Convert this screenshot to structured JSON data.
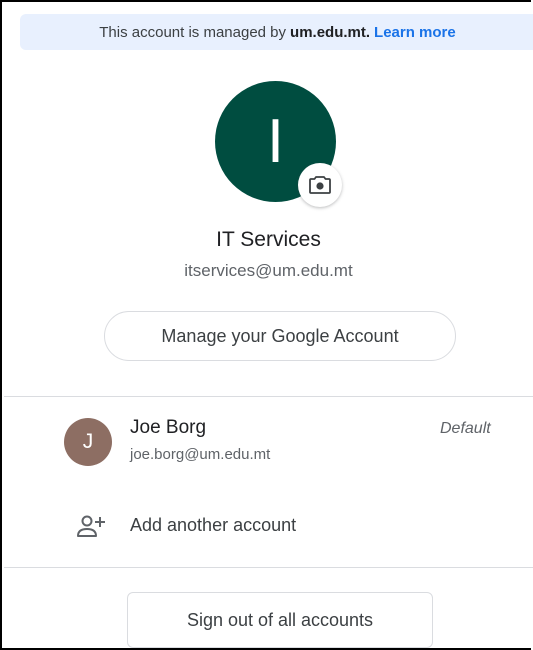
{
  "banner": {
    "prefix": "This account is managed by",
    "domain": "um.edu.mt.",
    "learn_more": "Learn more"
  },
  "profile": {
    "initial": "I",
    "name": "IT Services",
    "email": "itservices@um.edu.mt",
    "avatar_color": "#004d40",
    "camera_icon": "camera-icon"
  },
  "manage_button": "Manage your Google Account",
  "accounts": [
    {
      "initial": "J",
      "name": "Joe Borg",
      "email": "joe.borg@um.edu.mt",
      "badge": "Default",
      "avatar_color": "#8d6e63"
    }
  ],
  "add_account": {
    "label": "Add another account",
    "icon": "add-person-icon"
  },
  "signout_button": "Sign out of all accounts",
  "colors": {
    "accent": "#1a73e8",
    "banner_bg": "#e8f0fe",
    "divider": "#dadce0"
  }
}
